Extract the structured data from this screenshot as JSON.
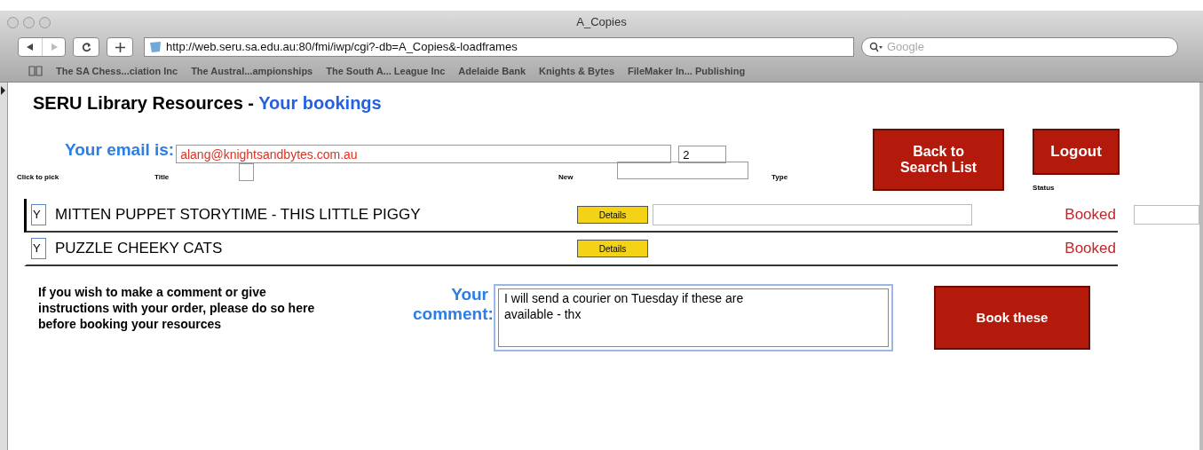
{
  "window": {
    "title": "A_Copies"
  },
  "toolbar": {
    "address": "http://web.seru.sa.edu.au:80/fmi/iwp/cgi?-db=A_Copies&-loadframes",
    "search_placeholder": "Google"
  },
  "bookmarks": [
    "The SA Chess...ciation Inc",
    "The Austral...ampionships",
    "The South A... League Inc",
    "Adelaide Bank",
    "Knights & Bytes",
    "FileMaker In... Publishing"
  ],
  "page": {
    "title": "SERU Library Resources - ",
    "subtitle": "Your bookings",
    "email_label": "Your email is:",
    "email": "alang@knightsandbytes.com.au",
    "count": "2",
    "back_button": "Back to\nSearch List",
    "logout_button": "Logout",
    "columns": [
      "Click to pick",
      "Title",
      "New",
      "Type",
      "Status"
    ],
    "title_checkbox": {
      "checked": false
    },
    "rows": [
      {
        "pick": "Y",
        "title": "MITTEN PUPPET STORYTIME - THIS LITTLE PIGGY",
        "details": "Details",
        "status": "Booked",
        "selected": true
      },
      {
        "pick": "Y",
        "title": "PUZZLE CHEEKY CATS",
        "details": "Details",
        "status": "Booked",
        "selected": false
      }
    ],
    "instructions": "If you wish to make a comment or give instructions with your order, please do so here before booking your resources",
    "comment_label": "Your comment:",
    "comment": "I will send a courier on Tuesday if these are available - thx",
    "book_button": "Book these"
  }
}
